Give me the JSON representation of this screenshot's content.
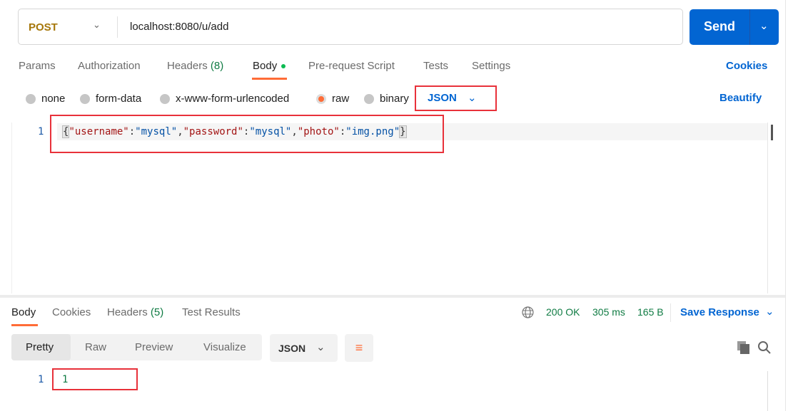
{
  "request": {
    "method": "POST",
    "url": "localhost:8080/u/add",
    "send_label": "Send"
  },
  "tabs": [
    {
      "label": "Params"
    },
    {
      "label": "Authorization"
    },
    {
      "label": "Headers",
      "count": "(8)"
    },
    {
      "label": "Body"
    },
    {
      "label": "Pre-request Script"
    },
    {
      "label": "Tests"
    },
    {
      "label": "Settings"
    }
  ],
  "cookies_label": "Cookies",
  "body_types": [
    "none",
    "form-data",
    "x-www-form-urlencoded",
    "raw",
    "binary"
  ],
  "selected_body_type": "raw",
  "format": "JSON",
  "beautify_label": "Beautify",
  "editor": {
    "line_number": "1",
    "tokens": [
      "{",
      "\"username\"",
      ":",
      "\"mysql\"",
      ",",
      "\"password\"",
      ":",
      "\"mysql\"",
      ",",
      "\"photo\"",
      ":",
      "\"img.png\"",
      "}"
    ]
  },
  "response": {
    "tabs": [
      {
        "label": "Body"
      },
      {
        "label": "Cookies"
      },
      {
        "label": "Headers",
        "count": "(5)"
      },
      {
        "label": "Test Results"
      }
    ],
    "status": "200 OK",
    "time": "305 ms",
    "size": "165 B",
    "save_label": "Save Response",
    "views": [
      "Pretty",
      "Raw",
      "Preview",
      "Visualize"
    ],
    "format": "JSON",
    "line_number": "1",
    "value": "1"
  },
  "colors": {
    "accent": "#ff6c37",
    "brand": "#0265d2",
    "highlight": "#e8313a",
    "success": "#0f7b43"
  }
}
